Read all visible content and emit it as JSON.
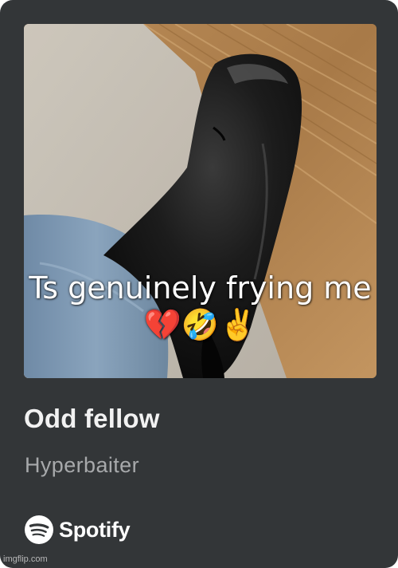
{
  "card": {
    "background_color": "#333638",
    "cover_image": {
      "icon": "cover-photo-boot",
      "caption": "Ts genuinely frying me 💔🤣✌️"
    },
    "track_title": "Odd fellow",
    "artist": "Hyperbaiter",
    "brand": {
      "icon": "spotify-logo-icon",
      "name": "Spotify"
    }
  },
  "watermark": "imgflip.com"
}
